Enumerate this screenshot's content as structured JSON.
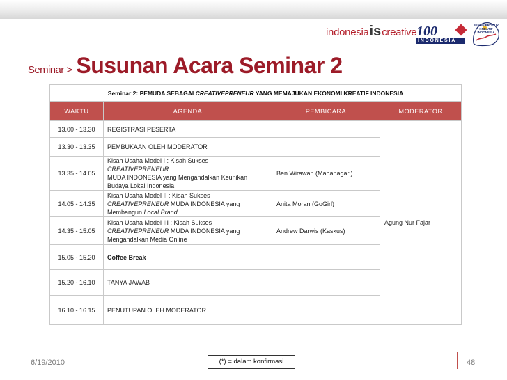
{
  "header": {
    "logo_indonesia": {
      "part1": "indonesia",
      "part2": "is",
      "part3": "creative"
    },
    "logo_100": {
      "number": "100",
      "sub": "INDONESIA",
      "icon": "heart-icon"
    },
    "logo_crest": {
      "text": "PEKAN PRODUK KREATIF INDONESIA"
    }
  },
  "title": {
    "prefix": "Seminar >",
    "main": "Susunan Acara Seminar 2"
  },
  "table": {
    "caption": {
      "before": "Seminar 2: PEMUDA SEBAGAI ",
      "italic": "CREATIVEPRENEUR",
      "after": " YANG MEMAJUKAN EKONOMI KREATIF INDONESIA"
    },
    "headers": {
      "time": "WAKTU",
      "agenda": "AGENDA",
      "speaker": "PEMBICARA",
      "moderator": "MODERATOR"
    },
    "moderator_name": "Agung Nur Fajar",
    "rows": [
      {
        "time": "13.00 - 13.30",
        "agenda": " REGISTRASI PESERTA",
        "speaker": ""
      },
      {
        "time": "13.30 - 13.35",
        "agenda": " PEMBUKAAN OLEH MODERATOR",
        "speaker": ""
      },
      {
        "time": "13.35 - 14.05",
        "agenda_line1": "Kisah Usaha Model I : Kisah Sukses ",
        "agenda_line1_italic": "CREATIVEPRENEUR",
        "agenda_line2": "MUDA INDONESIA  yang Mengandalkan Keunikan",
        "agenda_line3": "Budaya Lokal Indonesia",
        "speaker": " Ben Wirawan (Mahanagari)"
      },
      {
        "time": "14.05 - 14.35",
        "agenda_line1": "Kisah Usaha Model II : Kisah Sukses",
        "agenda_line2_italic": "CREATIVEPRENEUR",
        "agenda_line2": " MUDA INDONESIA yang",
        "agenda_line3": "Membangun ",
        "agenda_line3_italic": "Local Brand",
        "speaker": "Anita Moran (GoGirl)"
      },
      {
        "time": " 14.35 - 15.05",
        "agenda_line1": " Kisah Usaha Model III : Kisah Sukses",
        "agenda_line2_italic": "CREATIVEPRENEUR",
        "agenda_line2": " MUDA INDONESIA yang",
        "agenda_line3": "Mengandalkan Media Online",
        "speaker": "Andrew Darwis (Kaskus)"
      },
      {
        "time": "15.05 - 15.20",
        "agenda": "Coffee Break",
        "speaker": ""
      },
      {
        "time": "15.20 - 16.10",
        "agenda": "TANYA JAWAB",
        "speaker": ""
      },
      {
        "time": "16.10 - 16.15",
        "agenda": "PENUTUPAN OLEH MODERATOR",
        "speaker": ""
      }
    ]
  },
  "footer": {
    "date": "6/19/2010",
    "note": "(*) = dalam konfirmasi",
    "page": "48"
  },
  "colors": {
    "accent": "#c0504d",
    "title": "#9c1b28",
    "brand_blue": "#1b2a6e"
  }
}
